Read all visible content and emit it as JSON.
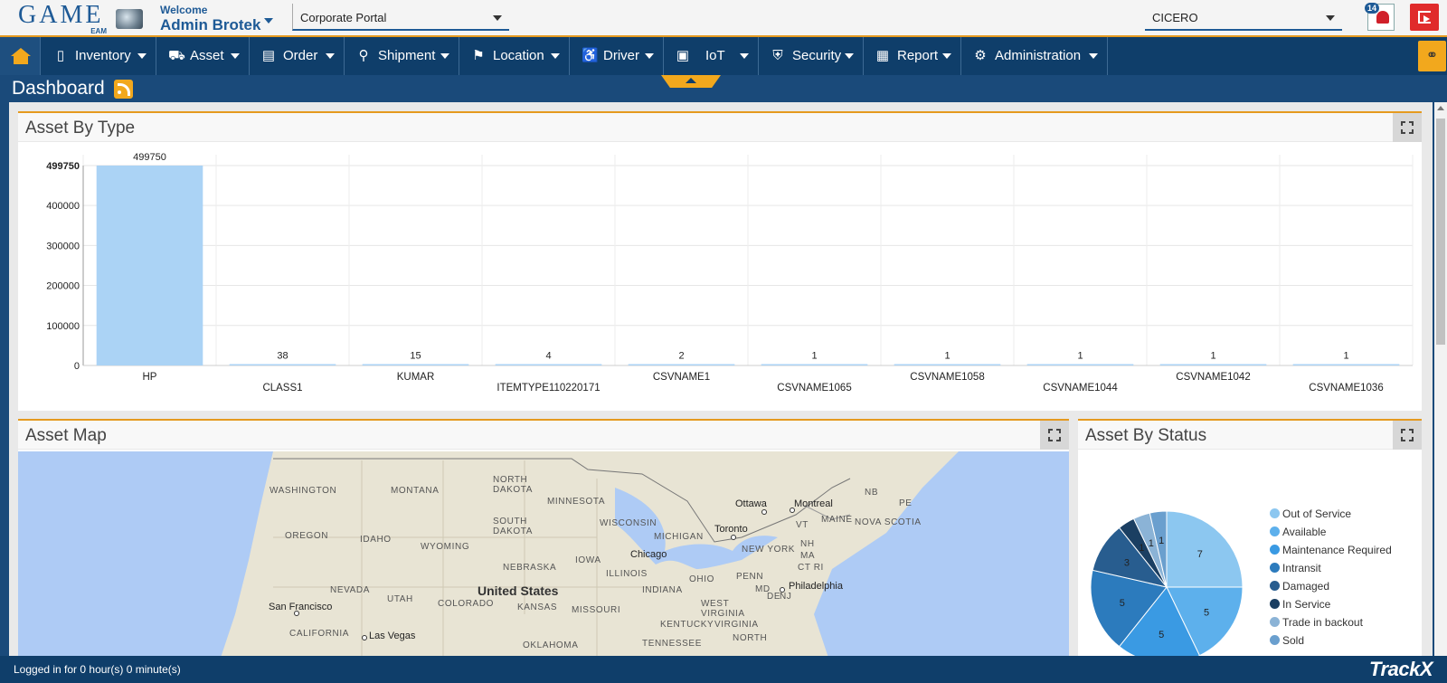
{
  "header": {
    "logo_text": "GAME",
    "logo_sub": "EAM",
    "welcome": "Welcome",
    "user_name": "Admin Brotek",
    "portal": "Corporate Portal",
    "tenant": "CICERO",
    "notifications": "14"
  },
  "nav": {
    "items": [
      {
        "label": "Inventory",
        "icon": "inventory-icon"
      },
      {
        "label": "Asset",
        "icon": "asset-icon"
      },
      {
        "label": "Order",
        "icon": "order-icon"
      },
      {
        "label": "Shipment",
        "icon": "shipment-icon"
      },
      {
        "label": "Location",
        "icon": "location-pin-icon"
      },
      {
        "label": "Driver",
        "icon": "driver-seat-icon"
      },
      {
        "label": "IoT",
        "icon": "chip-icon"
      },
      {
        "label": "Security",
        "icon": "shield-icon"
      },
      {
        "label": "Report",
        "icon": "clipboard-icon"
      },
      {
        "label": "Administration",
        "icon": "gears-icon"
      }
    ]
  },
  "page": {
    "title": "Dashboard"
  },
  "panels": {
    "asset_by_type": "Asset By Type",
    "asset_map": "Asset Map",
    "asset_by_status": "Asset By Status"
  },
  "chart_data": [
    {
      "type": "bar",
      "categories": [
        "HP",
        "CLASS1",
        "KUMAR",
        "ITEMTYPE110220171",
        "CSVNAME1",
        "CSVNAME1065",
        "CSVNAME1058",
        "CSVNAME1044",
        "CSVNAME1042",
        "CSVNAME1036"
      ],
      "values": [
        499750,
        38,
        15,
        4,
        2,
        1,
        1,
        1,
        1,
        1
      ],
      "ylim": [
        0,
        499750
      ],
      "yticks": [
        "0",
        "100000",
        "200000",
        "300000",
        "400000",
        "499750"
      ],
      "grid": true,
      "color": "#abd3f5"
    },
    {
      "type": "pie",
      "slices": [
        {
          "label": "Out of Service",
          "value": 7,
          "color": "#8cc7f0"
        },
        {
          "label": "Available",
          "value": 5,
          "color": "#5db0ec"
        },
        {
          "label": "Maintenance Required",
          "value": 5,
          "color": "#3a9ae3"
        },
        {
          "label": "Intransit",
          "value": 5,
          "color": "#2c7bbd"
        },
        {
          "label": "Damaged",
          "value": 3,
          "color": "#285d8f"
        },
        {
          "label": "In Service",
          "value": 1,
          "color": "#1b3f62"
        },
        {
          "label": "Trade in backout",
          "value": 1,
          "color": "#8bb3d6"
        },
        {
          "label": "Sold",
          "value": 1,
          "color": "#6a9fce"
        }
      ],
      "legend": "right"
    }
  ],
  "map": {
    "regions": [
      "WASHINGTON",
      "MONTANA",
      "NORTH DAKOTA",
      "MINNESOTA",
      "OREGON",
      "IDAHO",
      "WYOMING",
      "SOUTH DAKOTA",
      "NEBRASKA",
      "IOWA",
      "NEVADA",
      "UTAH",
      "COLORADO",
      "KANSAS",
      "MISSOURI",
      "ILLINOIS",
      "INDIANA",
      "OHIO",
      "CALIFORNIA",
      "WISCONSIN",
      "MICHIGAN",
      "NEW YORK",
      "PENN",
      "WEST VIRGINIA",
      "KENTUCKY",
      "VIRGINIA",
      "NORTH",
      "TENNESSEE",
      "OKLAHOMA",
      "MAINE",
      "NOVA SCOTIA",
      "NB",
      "PE",
      "VT",
      "NH",
      "MA",
      "CT RI",
      "MD",
      "DE",
      "NJ"
    ],
    "cities": [
      "Ottawa",
      "Montreal",
      "Toronto",
      "Chicago",
      "Philadelphia",
      "San Francisco",
      "Las Vegas"
    ],
    "country": "United States"
  },
  "footer": {
    "status": "Logged in for 0 hour(s) 0 minute(s)",
    "brand": "TrackX"
  }
}
